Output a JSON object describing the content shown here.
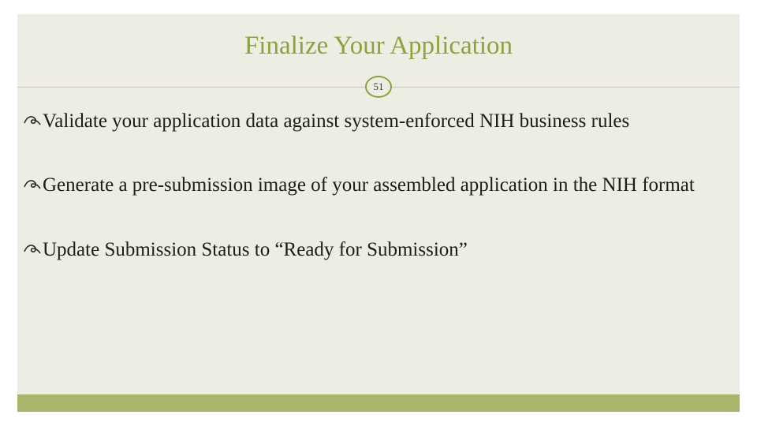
{
  "title": "Finalize Your Application",
  "slide_number": "51",
  "bullets": [
    "Validate your application data against system-enforced NIH business rules",
    "Generate a pre-submission image of your assembled application in the NIH format",
    "Update Submission Status to “Ready for Submission”"
  ],
  "colors": {
    "accent": "#8aa33b",
    "panel": "#eeede3",
    "footer": "#a8b56b"
  }
}
